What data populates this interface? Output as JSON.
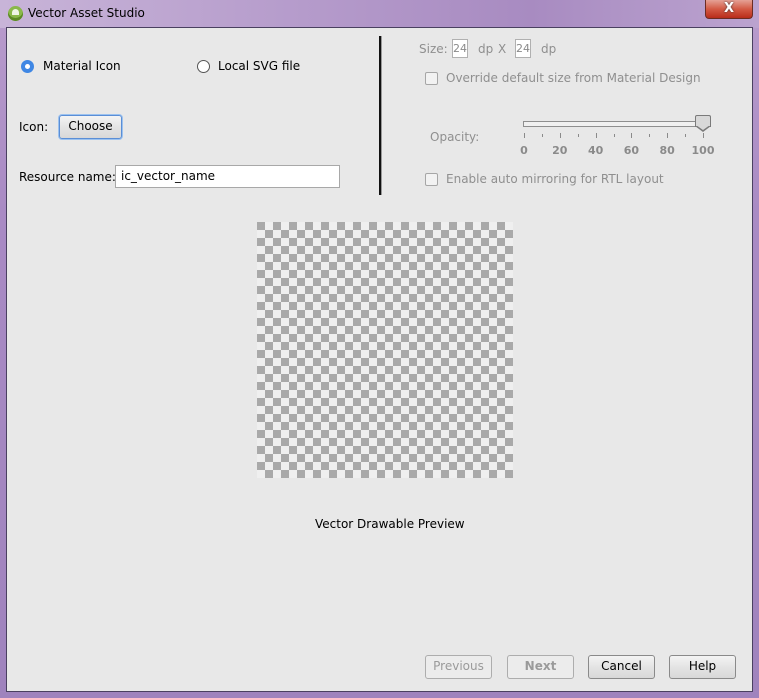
{
  "window": {
    "title": "Vector Asset Studio",
    "close_label": "X"
  },
  "source": {
    "options": [
      {
        "label": "Material Icon",
        "selected": true
      },
      {
        "label": "Local SVG file",
        "selected": false
      }
    ]
  },
  "icon": {
    "label": "Icon:",
    "choose_label": "Choose"
  },
  "resource": {
    "label": "Resource name:",
    "value": "ic_vector_name"
  },
  "size": {
    "label": "Size:",
    "width": "24",
    "unit1": "dp",
    "separator": "X",
    "height": "24",
    "unit2": "dp",
    "override_label": "Override default size from Material Design",
    "override_checked": false
  },
  "opacity": {
    "label": "Opacity:",
    "value": 100,
    "min": 0,
    "max": 100,
    "tick_labels": [
      "0",
      "20",
      "40",
      "60",
      "80",
      "100"
    ]
  },
  "mirroring": {
    "label": "Enable auto mirroring for RTL layout",
    "checked": false
  },
  "preview": {
    "caption": "Vector Drawable Preview"
  },
  "footer": {
    "previous_label": "Previous",
    "next_label": "Next",
    "cancel_label": "Cancel",
    "help_label": "Help"
  }
}
